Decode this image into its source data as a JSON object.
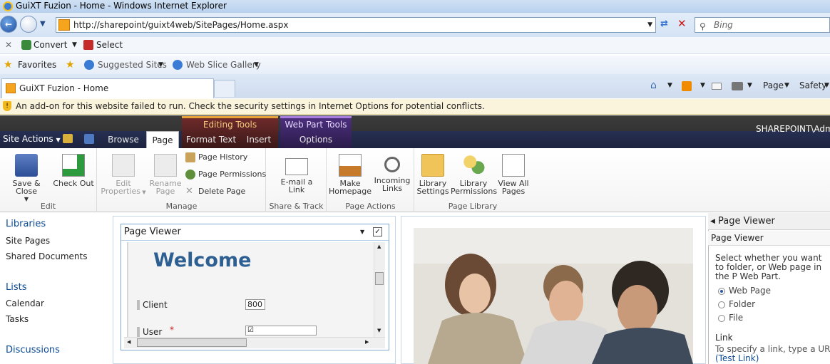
{
  "browser": {
    "window_title": "GuiXT Fuzion - Home - Windows Internet Explorer",
    "address": "http://sharepoint/guixt4web/SitePages/Home.aspx",
    "search_placeholder": "Bing",
    "convert_label": "Convert",
    "select_label": "Select",
    "favorites_label": "Favorites",
    "suggested_sites": "Suggested Sites",
    "web_slice_gallery": "Web Slice Gallery",
    "tab_title": "GuiXT Fuzion - Home",
    "cmd_page": "Page",
    "cmd_safety": "Safety",
    "infobar": "An add-on for this website failed to run. Check the security settings in Internet Options for potential conflicts."
  },
  "sharepoint": {
    "site_actions": "Site Actions",
    "tabs": {
      "browse": "Browse",
      "page": "Page",
      "format_text": "Format Text",
      "insert": "Insert",
      "options": "Options"
    },
    "contexts": {
      "editing_tools": "Editing Tools",
      "web_part_tools": "Web Part Tools"
    },
    "user": "SHAREPOINT\\Adm",
    "ribbon": {
      "edit_group": "Edit",
      "save_close": "Save & Close",
      "check_out": "Check Out",
      "manage_group": "Manage",
      "edit_properties_1": "Edit",
      "edit_properties_2": "Properties",
      "rename_page_1": "Rename",
      "rename_page_2": "Page",
      "page_history": "Page History",
      "page_permissions": "Page Permissions",
      "delete_page": "Delete Page",
      "share_group": "Share & Track",
      "email_link_1": "E-mail a",
      "email_link_2": "Link",
      "actions_group": "Page Actions",
      "make_homepage_1": "Make",
      "make_homepage_2": "Homepage",
      "incoming_links_1": "Incoming",
      "incoming_links_2": "Links",
      "library_group": "Page Library",
      "library_settings_1": "Library",
      "library_settings_2": "Settings",
      "library_permissions_1": "Library",
      "library_permissions_2": "Permissions",
      "view_all_1": "View All",
      "view_all_2": "Pages"
    },
    "nav": {
      "libraries": "Libraries",
      "site_pages": "Site Pages",
      "shared_documents": "Shared Documents",
      "lists": "Lists",
      "calendar": "Calendar",
      "tasks": "Tasks",
      "discussions": "Discussions"
    },
    "webpart": {
      "title": "Page Viewer",
      "welcome": "Welcome",
      "client_label": "Client",
      "client_value": "800",
      "user_label": "User",
      "required_mark": "*"
    },
    "toolpane": {
      "header": "Page Viewer",
      "subheader": "Page Viewer",
      "description": "Select whether you want to folder, or Web page in the P Web Part.",
      "option_web_page": "Web Page",
      "option_folder": "Folder",
      "option_file": "File",
      "selected_option": "Web Page",
      "link_label": "Link",
      "link_hint": "To specify a link, type a URL",
      "test_link": "(Test Link)"
    }
  }
}
